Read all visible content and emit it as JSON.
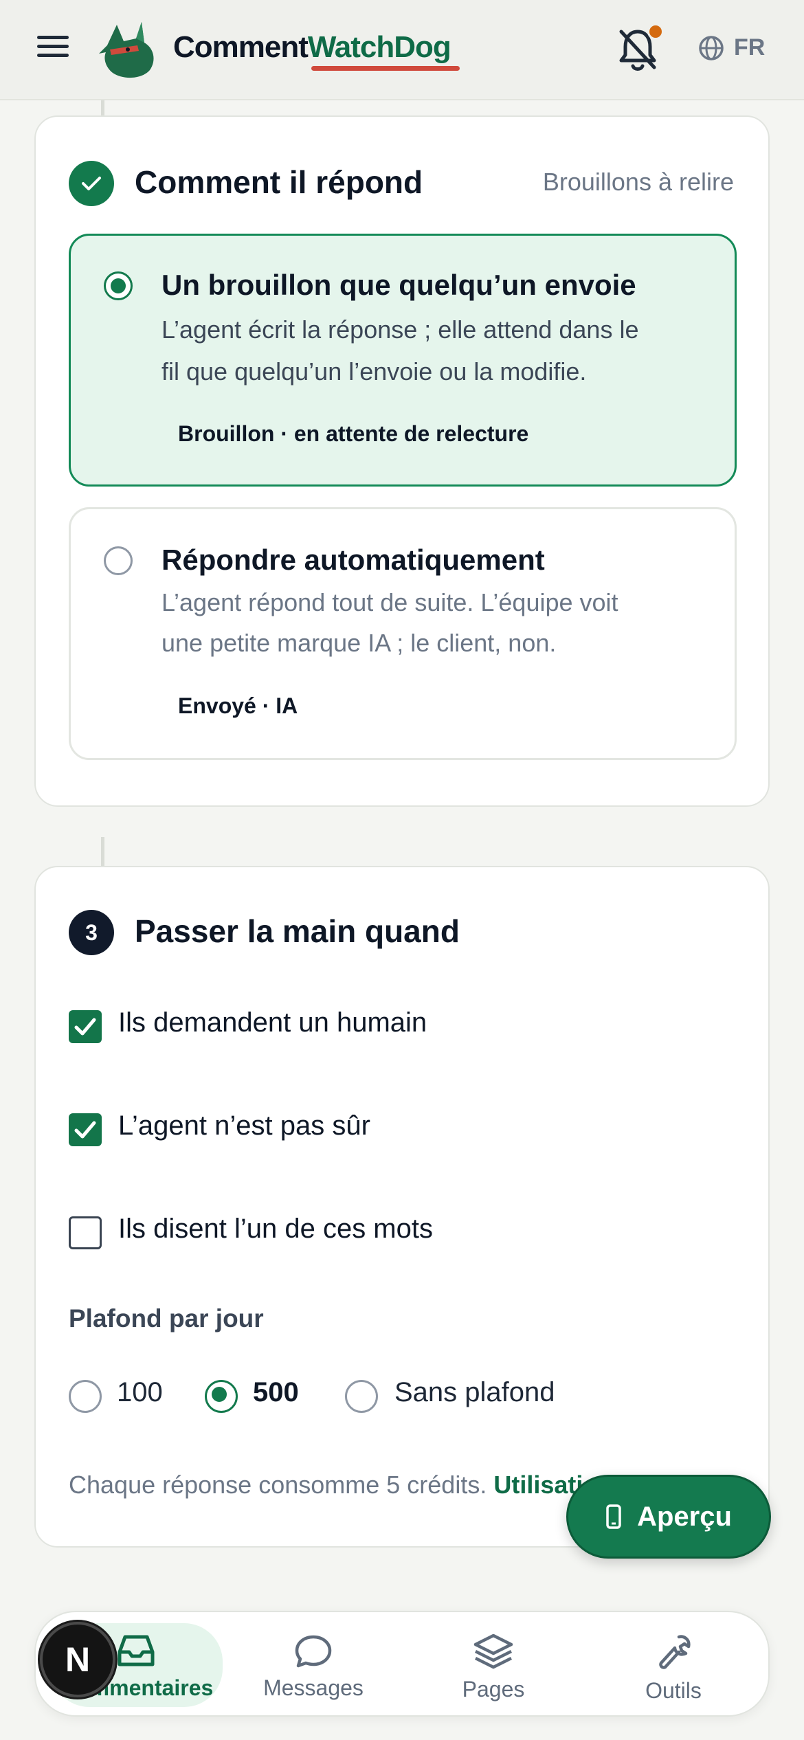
{
  "header": {
    "brand_part1": "Comment",
    "brand_part2": "WatchDog",
    "language": "FR",
    "colors": {
      "brand_green": "#0f6b47",
      "accent_red": "#d04a3c",
      "notif_dot": "#d46a0f"
    }
  },
  "response_step": {
    "title": "Comment il répond",
    "aside": "Brouillons à relire",
    "options": [
      {
        "title": "Un brouillon que quelqu’un envoie",
        "desc_line1": "L’agent écrit la réponse ; elle attend dans le",
        "desc_line2": "fil que quelqu’un l’envoie ou la modifie.",
        "tag": "Brouillon · en attente de relecture",
        "selected": true
      },
      {
        "title": "Répondre automatiquement",
        "desc_line1": "L’agent répond tout de suite. L’équipe voit",
        "desc_line2": "une petite marque IA ; le client, non.",
        "tag": "Envoyé · IA",
        "selected": false
      }
    ]
  },
  "handoff_step": {
    "number": "3",
    "title": "Passer la main quand",
    "checks": [
      {
        "label": "Ils demandent un humain",
        "checked": true
      },
      {
        "label": "L’agent n’est pas sûr",
        "checked": true
      },
      {
        "label": "Ils disent l’un de ces mots",
        "checked": false
      }
    ],
    "daily_cap_label": "Plafond par jour",
    "cap_options": [
      "100",
      "500",
      "Sans plafond"
    ],
    "cap_selected": "500",
    "note_text": "Chaque réponse consomme 5 crédits.",
    "note_link": "Utilisati"
  },
  "preview_button": "Aperçu",
  "bottom_nav": {
    "items": [
      "Commentaires",
      "Messages",
      "Pages",
      "Outils"
    ],
    "active": "Commentaires"
  },
  "avatar_letter": "N"
}
